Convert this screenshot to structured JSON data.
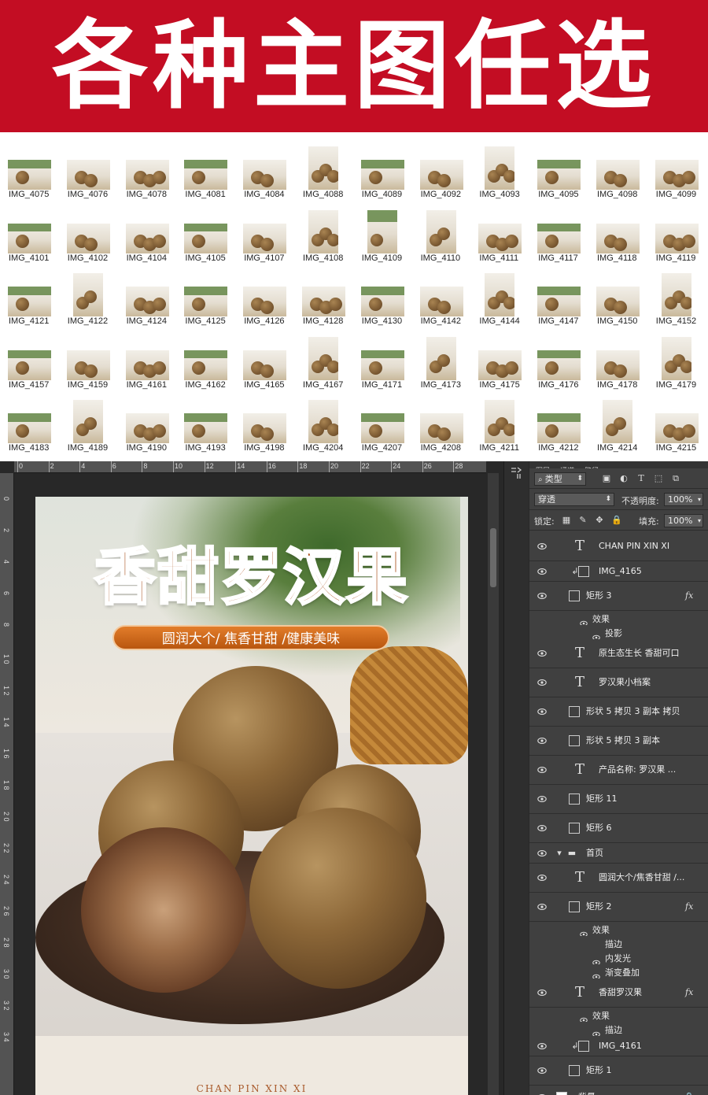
{
  "banner": {
    "title": "各种主图任选",
    "bg": "#c30d23"
  },
  "thumbnails": [
    "IMG_4075",
    "IMG_4076",
    "IMG_4078",
    "IMG_4081",
    "IMG_4084",
    "IMG_4088",
    "IMG_4089",
    "IMG_4092",
    "IMG_4093",
    "IMG_4095",
    "IMG_4098",
    "IMG_4099",
    "IMG_4101",
    "IMG_4102",
    "IMG_4104",
    "IMG_4105",
    "IMG_4107",
    "IMG_4108",
    "IMG_4109",
    "IMG_4110",
    "IMG_4111",
    "IMG_4117",
    "IMG_4118",
    "IMG_4119",
    "IMG_4121",
    "IMG_4122",
    "IMG_4124",
    "IMG_4125",
    "IMG_4126",
    "IMG_4128",
    "IMG_4130",
    "IMG_4142",
    "IMG_4144",
    "IMG_4147",
    "IMG_4150",
    "IMG_4152",
    "IMG_4157",
    "IMG_4159",
    "IMG_4161",
    "IMG_4162",
    "IMG_4165",
    "IMG_4167",
    "IMG_4171",
    "IMG_4173",
    "IMG_4175",
    "IMG_4176",
    "IMG_4178",
    "IMG_4179",
    "IMG_4183",
    "IMG_4189",
    "IMG_4190",
    "IMG_4193",
    "IMG_4198",
    "IMG_4204",
    "IMG_4207",
    "IMG_4208",
    "IMG_4211",
    "IMG_4212",
    "IMG_4214",
    "IMG_4215"
  ],
  "ruler": {
    "top": [
      "0",
      "2",
      "4",
      "6",
      "8",
      "10",
      "12",
      "14",
      "16",
      "18",
      "20",
      "22",
      "24",
      "26",
      "28"
    ],
    "left": [
      "0",
      "2",
      "4",
      "6",
      "8",
      "1 0",
      "1 2",
      "1 4",
      "1 6",
      "1 8",
      "2 0",
      "2 2",
      "2 4",
      "2 6",
      "2 8",
      "3 0",
      "3 2",
      "3 4"
    ]
  },
  "document": {
    "title": "香甜罗汉果",
    "pill": "圆润大个/ 焦香甘甜 /健康美味",
    "footer": "CHAN PIN XIN XI"
  },
  "panel": {
    "tabs": [
      "图层",
      "通道",
      "路径"
    ],
    "filter_kind": "类型",
    "blend_mode": "穿透",
    "opacity_label": "不透明度:",
    "opacity_value": "100%",
    "lock_label": "锁定:",
    "fill_label": "填充:",
    "fill_value": "100%"
  },
  "layers": [
    {
      "name": "CHAN PIN XIN XI",
      "kind": "text"
    },
    {
      "name": "IMG_4165",
      "kind": "smart"
    },
    {
      "name": "矩形 3",
      "kind": "shape",
      "fx": "fx"
    },
    {
      "name": "效果",
      "kind": "sub1"
    },
    {
      "name": "投影",
      "kind": "sub2"
    },
    {
      "name": "原生态生长 香甜可口",
      "kind": "text"
    },
    {
      "name": "罗汉果小档案",
      "kind": "text"
    },
    {
      "name": "形状 5 拷贝 3 副本 拷贝",
      "kind": "shape"
    },
    {
      "name": "形状 5 拷贝 3 副本",
      "kind": "shape"
    },
    {
      "name": "产品名称: 罗汉果     ...",
      "kind": "text"
    },
    {
      "name": "矩形 11",
      "kind": "shape"
    },
    {
      "name": "矩形 6",
      "kind": "shape"
    },
    {
      "name": "首页",
      "kind": "group"
    },
    {
      "name": "圆润大个/焦香甘甜 /...",
      "kind": "text"
    },
    {
      "name": "矩形 2",
      "kind": "shape",
      "fx": "fx"
    },
    {
      "name": "效果",
      "kind": "sub1"
    },
    {
      "name": "描边",
      "kind": "sub3"
    },
    {
      "name": "内发光",
      "kind": "sub2"
    },
    {
      "name": "渐变叠加",
      "kind": "sub2"
    },
    {
      "name": "香甜罗汉果",
      "kind": "text",
      "fx": "fx"
    },
    {
      "name": "效果",
      "kind": "sub1"
    },
    {
      "name": "描边",
      "kind": "sub2"
    },
    {
      "name": "IMG_4161",
      "kind": "smart"
    },
    {
      "name": "矩形 1",
      "kind": "shape"
    },
    {
      "name": "背景",
      "kind": "bg"
    }
  ]
}
